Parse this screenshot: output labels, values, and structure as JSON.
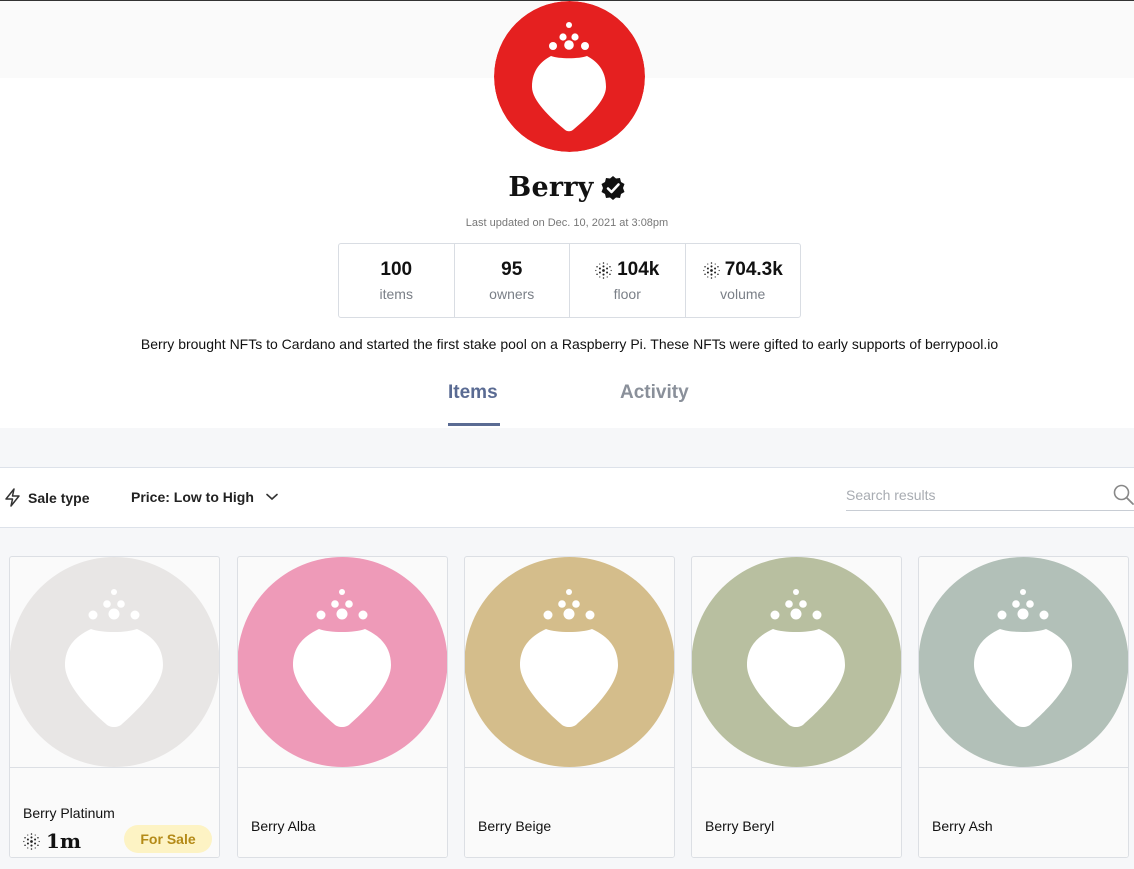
{
  "collection": {
    "name": "Berry",
    "last_updated": "Last updated on Dec. 10, 2021 at 3:08pm",
    "description": "Berry brought NFTs to Cardano and started the first stake pool on a Raspberry Pi. These NFTs were gifted to early supports of berrypool.io",
    "avatar_color": "#e52020",
    "verified_icon": "verified-badge-icon"
  },
  "stats": [
    {
      "value": "100",
      "label": "items",
      "icon": ""
    },
    {
      "value": "95",
      "label": "owners",
      "icon": ""
    },
    {
      "value": "104k",
      "label": "floor",
      "icon": "cardano-icon"
    },
    {
      "value": "704.3k",
      "label": "volume",
      "icon": "cardano-icon"
    }
  ],
  "tabs": [
    {
      "label": "Items",
      "active": true
    },
    {
      "label": "Activity",
      "active": false
    }
  ],
  "filters": {
    "sale_type": "Sale type",
    "sort": "Price: Low to High",
    "search_placeholder": "Search results"
  },
  "items": [
    {
      "name": "Berry Platinum",
      "color": "#e8e6e5",
      "price": "1m",
      "badge": "For Sale"
    },
    {
      "name": "Berry Alba",
      "color": "#ee9ab8"
    },
    {
      "name": "Berry Beige",
      "color": "#d4bd8b"
    },
    {
      "name": "Berry Beryl",
      "color": "#b8bfa0"
    },
    {
      "name": "Berry Ash",
      "color": "#b2c0b8"
    }
  ],
  "colors": {
    "accent": "#5a6b93",
    "badge_bg": "#fdf3c4",
    "badge_text": "#b48a17"
  }
}
